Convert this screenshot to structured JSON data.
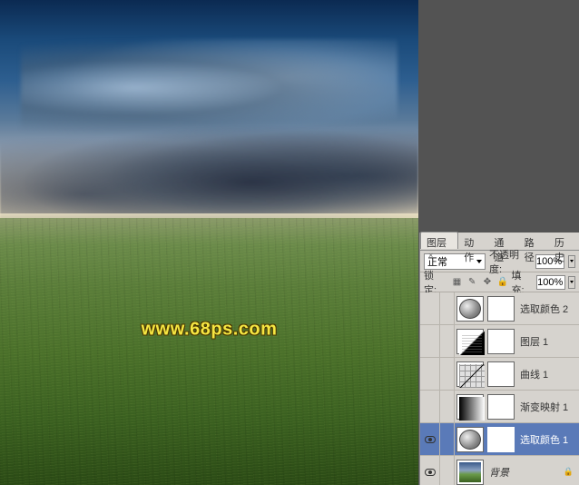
{
  "watermark": "www.68ps.com",
  "panel": {
    "tabs": {
      "layers": "图层",
      "actions": "动作",
      "channels": "通道",
      "paths": "路径",
      "history": "历史"
    },
    "blend_mode": "正常",
    "opacity_label": "不透明度:",
    "opacity_value": "100%",
    "lock_label": "锁定:",
    "fill_label": "填充:",
    "fill_value": "100%",
    "layers": [
      {
        "name": "选取颜色 2",
        "type": "selective-color",
        "visible": false,
        "selected": false
      },
      {
        "name": "图层 1",
        "type": "levels",
        "visible": false,
        "selected": false
      },
      {
        "name": "曲线 1",
        "type": "curves",
        "visible": false,
        "selected": false
      },
      {
        "name": "渐变映射 1",
        "type": "gradient-map",
        "visible": false,
        "selected": false
      },
      {
        "name": "选取颜色 1",
        "type": "selective-color",
        "visible": true,
        "selected": true
      },
      {
        "name": "背景",
        "type": "background",
        "visible": true,
        "selected": false
      }
    ]
  }
}
